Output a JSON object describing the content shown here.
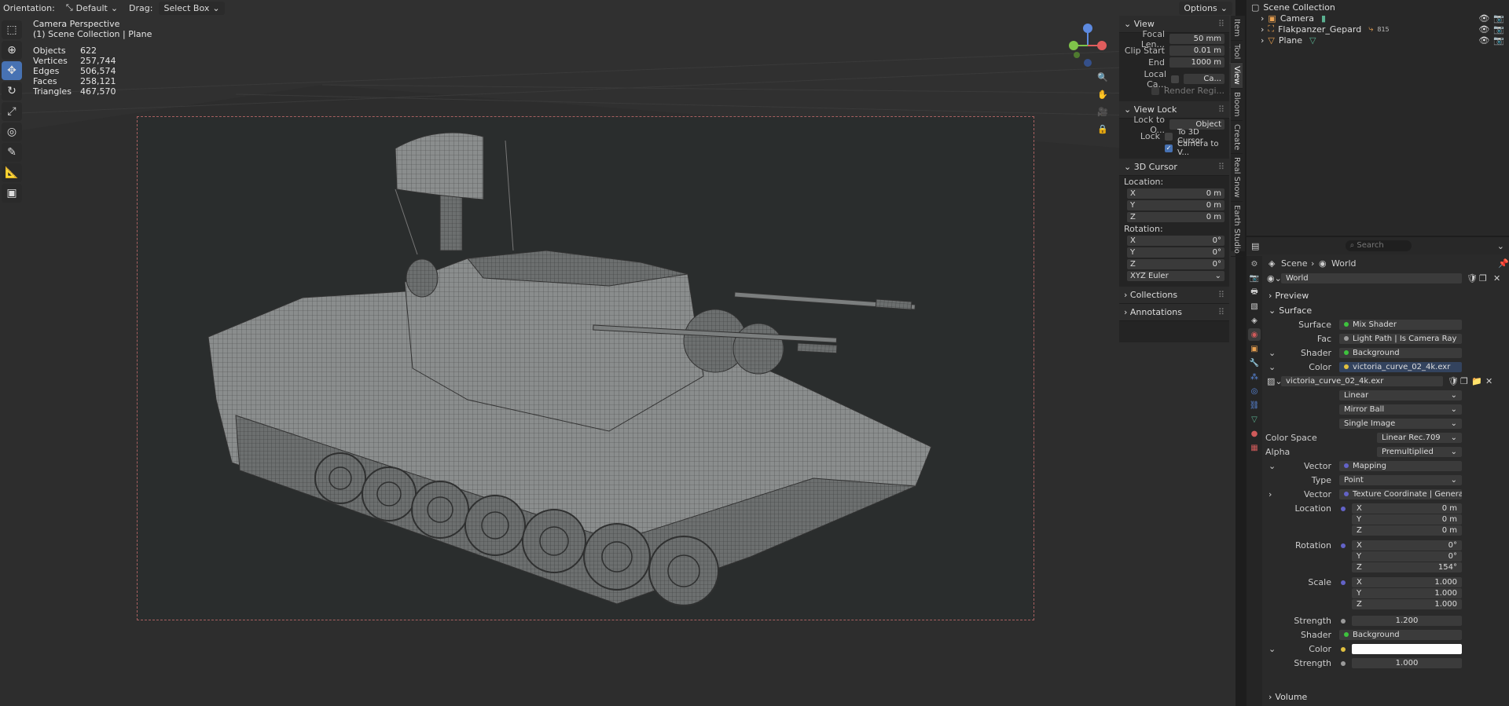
{
  "header": {
    "orientation_label": "Orientation:",
    "orientation_value": "Default",
    "drag_label": "Drag:",
    "drag_value": "Select Box",
    "options_label": "Options"
  },
  "overlay": {
    "line1": "Camera Perspective",
    "line2": "(1) Scene Collection | Plane",
    "stats": [
      {
        "label": "Objects",
        "value": "622"
      },
      {
        "label": "Vertices",
        "value": "257,744"
      },
      {
        "label": "Edges",
        "value": "506,574"
      },
      {
        "label": "Faces",
        "value": "258,121"
      },
      {
        "label": "Triangles",
        "value": "467,570"
      }
    ]
  },
  "npanel": {
    "view_title": "View",
    "focal_label": "Focal Len...",
    "focal_value": "50 mm",
    "clip_start_label": "Clip Start",
    "clip_start_value": "0.01 m",
    "end_label": "End",
    "end_value": "1000 m",
    "local_cam_label": "Local Ca...",
    "local_cam_value": "Ca...",
    "render_region": "Render Regi...",
    "view_lock_title": "View Lock",
    "lock_to_label": "Lock to O...",
    "lock_to_value": "Object",
    "lock_label": "Lock",
    "to_3d_cursor": "To 3D Cursor",
    "camera_to_view": "Camera to V...",
    "cursor_title": "3D Cursor",
    "location_label": "Location:",
    "loc": [
      {
        "axis": "X",
        "value": "0 m"
      },
      {
        "axis": "Y",
        "value": "0 m"
      },
      {
        "axis": "Z",
        "value": "0 m"
      }
    ],
    "rotation_label": "Rotation:",
    "rot": [
      {
        "axis": "X",
        "value": "0°"
      },
      {
        "axis": "Y",
        "value": "0°"
      },
      {
        "axis": "Z",
        "value": "0°"
      }
    ],
    "rot_mode": "XYZ Euler",
    "collections": "Collections",
    "annotations": "Annotations"
  },
  "vtabs": [
    "Item",
    "Tool",
    "View",
    "Bloom",
    "Create",
    "Real Snow",
    "Earth Studio"
  ],
  "outliner": {
    "title": "Scene Collection",
    "items": [
      {
        "name": "Camera"
      },
      {
        "name": "Flakpanzer_Gepard",
        "badge": "815"
      },
      {
        "name": "Plane"
      }
    ]
  },
  "properties": {
    "search_placeholder": "Search",
    "breadcrumb_scene": "Scene",
    "breadcrumb_world": "World",
    "world_name": "World",
    "preview": "Preview",
    "surface_section": "Surface",
    "surface_label": "Surface",
    "surface_value": "Mix Shader",
    "fac_label": "Fac",
    "fac_value": "Light Path | Is Camera Ray",
    "shader_label": "Shader",
    "shader_value": "Background",
    "color_label": "Color",
    "color_value": "victoria_curve_02_4k.exr",
    "image_name": "victoria_curve_02_4k.exr",
    "interp": "Linear",
    "projection": "Mirror Ball",
    "source": "Single Image",
    "colorspace_label": "Color Space",
    "colorspace_value": "Linear Rec.709",
    "alpha_label": "Alpha",
    "alpha_value": "Premultiplied",
    "vector_label": "Vector",
    "vector_value": "Mapping",
    "type_label": "Type",
    "type_value": "Point",
    "vector2_label": "Vector",
    "vector2_value": "Texture Coordinate | Generated",
    "location_label": "Location",
    "location": [
      {
        "axis": "X",
        "value": "0 m"
      },
      {
        "axis": "Y",
        "value": "0 m"
      },
      {
        "axis": "Z",
        "value": "0 m"
      }
    ],
    "rotation_label": "Rotation",
    "rotation": [
      {
        "axis": "X",
        "value": "0°"
      },
      {
        "axis": "Y",
        "value": "0°"
      },
      {
        "axis": "Z",
        "value": "154°"
      }
    ],
    "scale_label": "Scale",
    "scale": [
      {
        "axis": "X",
        "value": "1.000"
      },
      {
        "axis": "Y",
        "value": "1.000"
      },
      {
        "axis": "Z",
        "value": "1.000"
      }
    ],
    "strength_label": "Strength",
    "strength_value": "1.200",
    "shader2_label": "Shader",
    "shader2_value": "Background",
    "color2_label": "Color",
    "strength2_label": "Strength",
    "strength2_value": "1.000",
    "volume": "Volume"
  },
  "colors": {
    "accent": "#4772b3",
    "frame": "#a86060",
    "white_swatch": "#ffffff"
  }
}
